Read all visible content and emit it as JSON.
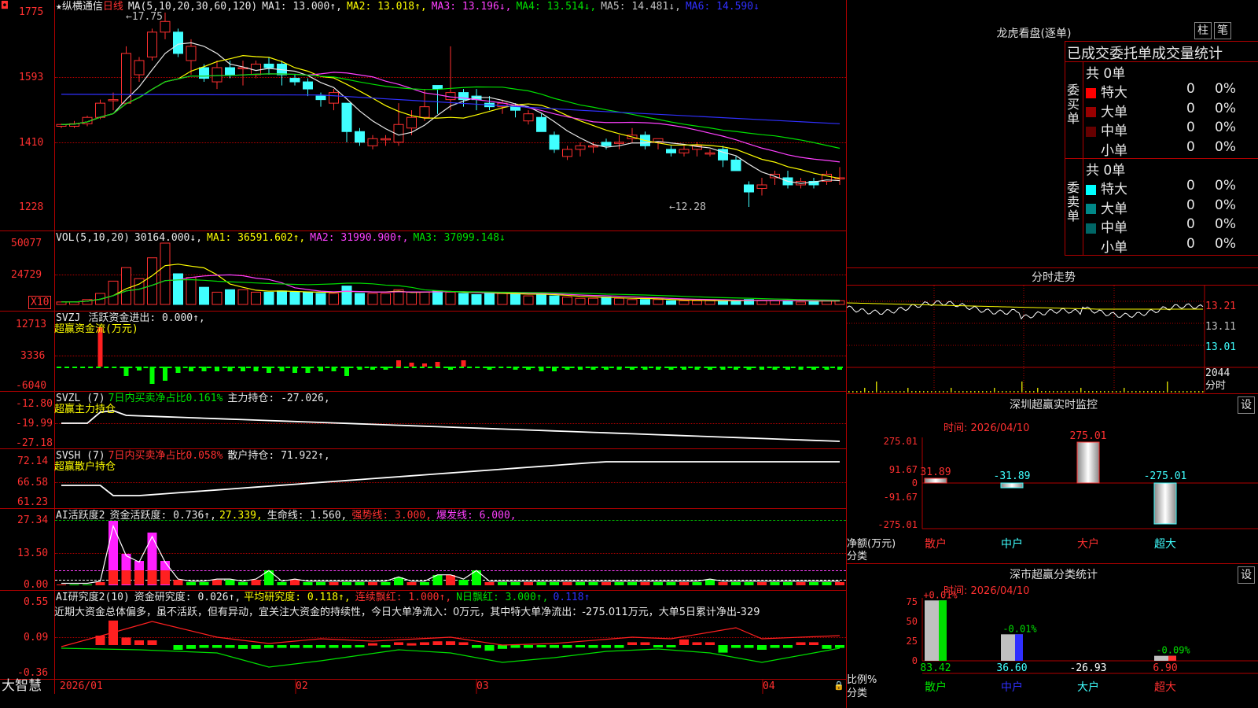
{
  "app_name": "大智慧",
  "main_header": {
    "star": "★",
    "stock_name": "纵横通信",
    "period": "日线",
    "ma_params": "MA(5,10,20,30,60,120)",
    "ma1": "MA1: 13.000↑,",
    "ma2": "MA2: 13.018↑,",
    "ma3": "MA3: 13.196↓,",
    "ma4": "MA4: 13.514↓,",
    "ma5": "MA5: 14.481↓,",
    "ma6": "MA6: 14.590↓"
  },
  "price_axis": [
    "1775",
    "1593",
    "1410",
    "1228"
  ],
  "high_mark": "←17.75",
  "low_mark": "←12.28",
  "vol_header": {
    "name": "VOL(5,10,20)",
    "value": "30164.000↓,",
    "ma1": "MA1: 36591.602↑,",
    "ma2": "MA2: 31990.900↑,",
    "ma3": "MA3: 37099.148↓"
  },
  "vol_axis": [
    "50077",
    "24729"
  ],
  "vol_unit": "X10",
  "svzj_header": {
    "name": "SVZJ",
    "text": "活跃资金进出: 0.000↑,",
    "subtitle": "超赢资金流(万元)"
  },
  "svzj_axis": [
    "12713",
    "3336",
    "-6040"
  ],
  "svzl_header": {
    "name": "SVZL (7)",
    "ratio": "7日内买卖净占比0.161%",
    "text": "主力持仓: -27.026,",
    "subtitle": "超赢主力持仓"
  },
  "svzl_axis": [
    "-12.80",
    "-19.99",
    "-27.18"
  ],
  "svsh_header": {
    "name": "SVSH (7)",
    "ratio": "7日内买卖净占比0.058%",
    "text": "散户持仓: 71.922↑,",
    "subtitle": "超赢散户持仓"
  },
  "svsh_axis": [
    "72.14",
    "66.58",
    "61.23"
  ],
  "ai_header": {
    "name": "AI活跃度2",
    "text": "资金活跃度: 0.736↑,",
    "v2": "27.339,",
    "life": "生命线: 1.560,",
    "strong": "强势线: 3.000,",
    "burst": "爆发线: 6.000,"
  },
  "ai_axis": [
    "27.34",
    "13.50",
    "0.00"
  ],
  "research_header": {
    "name": "AI研究度2(10)",
    "text": "资金研究度: 0.026↑,",
    "avg": "平均研究度: 0.118↑,",
    "cont": "连续飘红: 1.000↑,",
    "nday": "N日飘红: 3.000↑,",
    "v": "0.118↑"
  },
  "research_comment": "近期大资金总体偏多，虽不活跃，但有异动，宜关注大资金的持续性，今日大单净流入：0万元，其中特大单净流出：-275.011万元，大单5日累计净出-329",
  "research_axis": [
    "0.55",
    "0.09",
    "-0.36"
  ],
  "date_axis": [
    "2026/01",
    "02",
    "03",
    "04"
  ],
  "right": {
    "title": "龙虎看盘(逐单)",
    "tab1": "柱",
    "tab2": "笔",
    "stats_title": "已成交委托单成交量统计",
    "buy_label": "委买单",
    "sell_label": "委卖单",
    "buy_total": "共 0单",
    "sell_total": "共 0单",
    "buy_rows": [
      {
        "name": "特大",
        "count": "0",
        "pct": "0%",
        "color": "#ff0000"
      },
      {
        "name": "大单",
        "count": "0",
        "pct": "0%",
        "color": "#990000"
      },
      {
        "name": "中单",
        "count": "0",
        "pct": "0%",
        "color": "#660000"
      },
      {
        "name": "小单",
        "count": "0",
        "pct": "0%",
        "color": "#000000"
      }
    ],
    "sell_rows": [
      {
        "name": "特大",
        "count": "0",
        "pct": "0%",
        "color": "#00ffff"
      },
      {
        "name": "大单",
        "count": "0",
        "pct": "0%",
        "color": "#008888"
      },
      {
        "name": "中单",
        "count": "0",
        "pct": "0%",
        "color": "#006666"
      },
      {
        "name": "小单",
        "count": "0",
        "pct": "0%",
        "color": "#000000"
      }
    ],
    "intraday_title": "分时走势",
    "intraday_axis": [
      "13.21",
      "13.11",
      "13.01",
      "2044"
    ],
    "intraday_unit": "分时",
    "monitor_title": "深圳超赢实时监控",
    "settings": "设",
    "monitor_time": "时间: 2026/04/10",
    "monitor_axis": [
      "275.01",
      "91.67",
      "0",
      "-91.67",
      "-275.01"
    ],
    "monitor_unit1": "净额(万元)",
    "monitor_unit2": "分类",
    "monitor_cats": [
      "散户",
      "中户",
      "大户",
      "超大"
    ],
    "monitor_values": [
      "31.89",
      "-31.89",
      "275.01",
      "-275.01"
    ],
    "class_title": "深市超赢分类统计",
    "class_time": "时间: 2026/04/10",
    "class_axis": [
      "75",
      "50",
      "25",
      "0"
    ],
    "class_unit1": "比例%",
    "class_unit2": "分类",
    "class_cats": [
      "散户",
      "中户",
      "大户",
      "超大"
    ],
    "class_top": [
      "+0.01%",
      "-0.01%",
      "",
      "-0.09%"
    ],
    "class_values": [
      "83.42",
      "36.60",
      "-26.93",
      "6.90"
    ]
  }
}
